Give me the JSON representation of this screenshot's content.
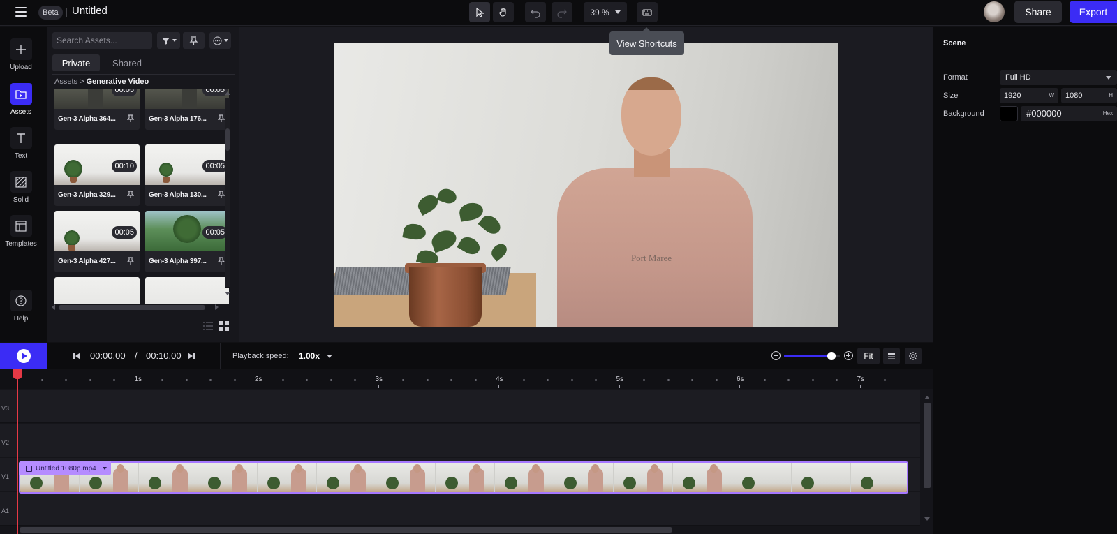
{
  "app": {
    "beta_label": "Beta",
    "title_sep": "|",
    "title": "Untitled"
  },
  "toolbar": {
    "zoom": "39 %",
    "tooltip": "View Shortcuts",
    "share_label": "Share",
    "export_label": "Export",
    "tools": [
      "select-tool",
      "hand-tool",
      "undo",
      "redo",
      "keyboard-shortcuts"
    ]
  },
  "leftnav": {
    "items": [
      {
        "label": "Upload",
        "icon": "plus-icon"
      },
      {
        "label": "Assets",
        "icon": "folder-icon",
        "active": true
      },
      {
        "label": "Text",
        "icon": "text-icon"
      },
      {
        "label": "Solid",
        "icon": "hatch-icon"
      },
      {
        "label": "Templates",
        "icon": "layout-icon"
      },
      {
        "label": "Help",
        "icon": "help-icon"
      }
    ]
  },
  "assets": {
    "search_placeholder": "Search Assets...",
    "tabs": [
      "Private",
      "Shared"
    ],
    "breadcrumb": {
      "root": "Assets",
      "sep": ">",
      "current": "Generative Video"
    },
    "cards": [
      {
        "name": "Gen-3 Alpha 364...",
        "duration": "00:05",
        "thumb": "person"
      },
      {
        "name": "Gen-3 Alpha 176...",
        "duration": "00:05",
        "thumb": "person"
      },
      {
        "name": "Gen-3 Alpha 329...",
        "duration": "00:10",
        "thumb": "plant"
      },
      {
        "name": "Gen-3 Alpha 130...",
        "duration": "00:05",
        "thumb": "plant"
      },
      {
        "name": "Gen-3 Alpha 427...",
        "duration": "00:05",
        "thumb": "plant"
      },
      {
        "name": "Gen-3 Alpha 397...",
        "duration": "00:05",
        "thumb": "green"
      },
      {
        "name": "",
        "duration": "",
        "thumb": "white"
      },
      {
        "name": "",
        "duration": "",
        "thumb": "white"
      }
    ]
  },
  "preview": {
    "shirt_print": "Port Maree"
  },
  "scene": {
    "title": "Scene",
    "format_label": "Format",
    "format_value": "Full HD",
    "size_label": "Size",
    "width": "1920",
    "width_unit": "W",
    "height": "1080",
    "height_unit": "H",
    "background_label": "Background",
    "background_hex": "#000000",
    "hex_unit": "Hex",
    "background_color": "#000000"
  },
  "playback": {
    "current_time": "00:00.00",
    "time_sep": "/",
    "total_time": "00:10.00",
    "speed_label": "Playback speed:",
    "speed_value": "1.00x",
    "zoom_level": 0.85,
    "fit_label": "Fit"
  },
  "timeline": {
    "ruler_labels": [
      "1s",
      "2s",
      "3s",
      "4s",
      "5s",
      "6s",
      "7s"
    ],
    "tracks": [
      "V3",
      "V2",
      "V1",
      "A1"
    ],
    "clip_name": "Untitled 1080p.mp4",
    "clip_color": "#a678ff",
    "playhead_color": "#e63946"
  },
  "colors": {
    "accent": "#3b2cf5",
    "panel": "#17171c",
    "background": "#111114"
  }
}
